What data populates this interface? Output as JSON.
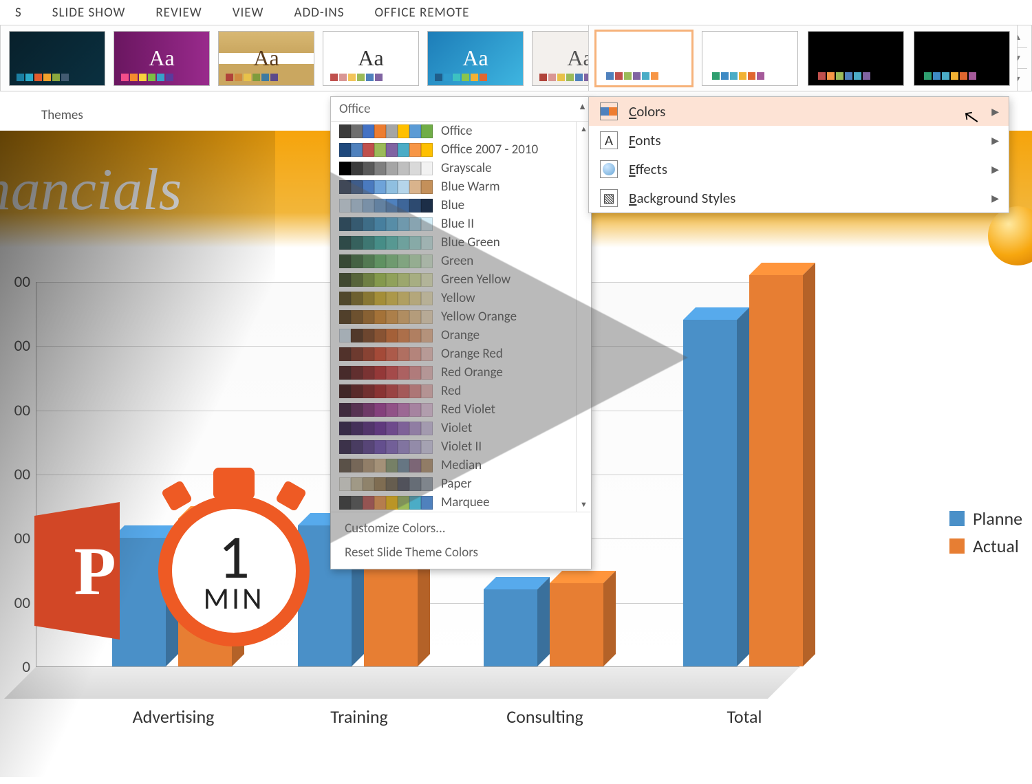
{
  "ribbon_tabs": [
    "S",
    "SLIDE SHOW",
    "REVIEW",
    "VIEW",
    "ADD-INS",
    "OFFICE REMOTE"
  ],
  "themes_label": "Themes",
  "theme_thumbs": [
    {
      "cls": "tt-dark",
      "aa": "",
      "pal": [
        "#1b7fa3",
        "#2aa9c9",
        "#e25a2c",
        "#f0a12b",
        "#8aa83e",
        "#425b71"
      ]
    },
    {
      "cls": "tt-purpl",
      "aa": "Aa",
      "pal": [
        "#f24d8a",
        "#f58b2e",
        "#f7d13d",
        "#7bc043",
        "#36a2c9",
        "#5a3b9c"
      ]
    },
    {
      "cls": "tt-wood",
      "aa": "Aa",
      "pal": [
        "#b0433a",
        "#d08a3f",
        "#e8c24a",
        "#7e9b3c",
        "#3f7aa1",
        "#5c4a8a"
      ]
    },
    {
      "cls": "tt-white",
      "aa": "Aa",
      "pal": [
        "#c0504d",
        "#d99694",
        "#f2c45a",
        "#9bbb59",
        "#4f81bd",
        "#8064a2"
      ]
    },
    {
      "cls": "tt-blue",
      "aa": "Aa",
      "pal": [
        "#205e8a",
        "#2e9bcd",
        "#3dc1c1",
        "#8ac54b",
        "#f2b233",
        "#e0662f"
      ]
    },
    {
      "cls": "tt-grey",
      "aa": "Aa",
      "pal": [
        "#b0433a",
        "#d99694",
        "#e8c24a",
        "#9bbb59",
        "#4f81bd",
        "#8064a2"
      ]
    }
  ],
  "variant_thumbs": [
    {
      "sel": true,
      "dark": false,
      "pal": [
        "#4f81bd",
        "#c0504d",
        "#9bbb59",
        "#8064a2",
        "#4bacc6",
        "#f79646"
      ]
    },
    {
      "sel": false,
      "dark": false,
      "pal": [
        "#2e9e6f",
        "#3e8ac4",
        "#4bacc6",
        "#f2b233",
        "#e0662f",
        "#a55a9a"
      ]
    },
    {
      "sel": false,
      "dark": true,
      "pal": [
        "#c0504d",
        "#f79646",
        "#9bbb59",
        "#4f81bd",
        "#4bacc6",
        "#8064a2"
      ]
    },
    {
      "sel": false,
      "dark": true,
      "pal": [
        "#2e9e6f",
        "#3e8ac4",
        "#4bacc6",
        "#f2b233",
        "#e0662f",
        "#a55a9a"
      ]
    }
  ],
  "colors_panel": {
    "header": "Office",
    "rows": [
      {
        "label": "Office",
        "sw": [
          "#3b3b3b",
          "#6f6f6f",
          "#4472c4",
          "#ed7d31",
          "#a5a5a5",
          "#ffc000",
          "#5b9bd5",
          "#70ad47"
        ]
      },
      {
        "label": "Office 2007 - 2010",
        "sw": [
          "#1f497d",
          "#4f81bd",
          "#c0504d",
          "#9bbb59",
          "#8064a2",
          "#4bacc6",
          "#f79646",
          "#ffc000"
        ]
      },
      {
        "label": "Grayscale",
        "sw": [
          "#000000",
          "#3b3b3b",
          "#595959",
          "#7f7f7f",
          "#a5a5a5",
          "#bfbfbf",
          "#d9d9d9",
          "#f2f2f2"
        ]
      },
      {
        "label": "Blue Warm",
        "sw": [
          "#2e3b55",
          "#3e5c8a",
          "#4a7abf",
          "#6ea3d9",
          "#8fbfe0",
          "#b5d5ea",
          "#d9b38c",
          "#c4905a"
        ]
      },
      {
        "label": "Blue",
        "sw": [
          "#dbe9f5",
          "#b5d0ea",
          "#8fb7df",
          "#699dd3",
          "#4f81bd",
          "#3e6699",
          "#2d4a70",
          "#1c2e47"
        ]
      },
      {
        "label": "Blue II",
        "sw": [
          "#0f3b57",
          "#1c5a80",
          "#2a7aa8",
          "#3a99cf",
          "#55b1df",
          "#7ec6e8",
          "#a9daef",
          "#d4edf7"
        ]
      },
      {
        "label": "Blue Green",
        "sw": [
          "#103f3c",
          "#1d6660",
          "#2a8c84",
          "#38b2a8",
          "#55c5bb",
          "#7dd5cd",
          "#a7e4de",
          "#d1f2ef"
        ]
      },
      {
        "label": "Green",
        "sw": [
          "#1f3d1a",
          "#356633",
          "#4c8f4c",
          "#62b866",
          "#7ec97f",
          "#9ed99b",
          "#bfe9b9",
          "#e0f4dc"
        ]
      },
      {
        "label": "Green Yellow",
        "sw": [
          "#2f3d14",
          "#556b23",
          "#7c9932",
          "#a3c742",
          "#b7d45a",
          "#cbdf7b",
          "#dfea9f",
          "#f1f4c7"
        ]
      },
      {
        "label": "Yellow",
        "sw": [
          "#4a3c0a",
          "#7a6410",
          "#aa8c18",
          "#d9b420",
          "#e7c43f",
          "#eed167",
          "#f4df93",
          "#faeec2"
        ]
      },
      {
        "label": "Yellow Orange",
        "sw": [
          "#4a2d0a",
          "#7a4a10",
          "#aa6718",
          "#d98420",
          "#e79a3f",
          "#eeb267",
          "#f4cb93",
          "#fae3c2"
        ]
      },
      {
        "label": "Orange",
        "sw": [
          "#d9e8f5",
          "#4a220a",
          "#7a3810",
          "#aa4e18",
          "#d96420",
          "#e77e3f",
          "#ee9a67",
          "#f4ba93"
        ]
      },
      {
        "label": "Orange Red",
        "sw": [
          "#4a150a",
          "#7a2310",
          "#aa3118",
          "#d93f20",
          "#e75a3f",
          "#ee7e67",
          "#f4a393",
          "#fac9c2"
        ]
      },
      {
        "label": "Red Orange",
        "sw": [
          "#3a0a0a",
          "#661010",
          "#921818",
          "#bd2020",
          "#d93f3f",
          "#e76767",
          "#ee9393",
          "#f4c2c2"
        ]
      },
      {
        "label": "Red",
        "sw": [
          "#300000",
          "#590808",
          "#821010",
          "#ab1818",
          "#c73232",
          "#d95959",
          "#e98a8a",
          "#f4bcbc"
        ]
      },
      {
        "label": "Red Violet",
        "sw": [
          "#2e0a2a",
          "#55164d",
          "#7c2270",
          "#a32e94",
          "#b84da8",
          "#cb73bd",
          "#dda0d2",
          "#efcde8"
        ]
      },
      {
        "label": "Violet",
        "sw": [
          "#1e0a3a",
          "#351259",
          "#4c1a78",
          "#632297",
          "#7c3fb0",
          "#9866c4",
          "#b796d8",
          "#d8c8ec"
        ]
      },
      {
        "label": "Violet II",
        "sw": [
          "#26163f",
          "#3d2666",
          "#55368c",
          "#6c47b3",
          "#8363c4",
          "#9e87d3",
          "#bcaee2",
          "#dbd6f1"
        ]
      },
      {
        "label": "Median",
        "sw": [
          "#5a4a3c",
          "#8a7157",
          "#b89872",
          "#d9b98e",
          "#8a9b6e",
          "#6e8aa1",
          "#946e8a",
          "#b8946e"
        ]
      },
      {
        "label": "Paper",
        "sw": [
          "#f0eee6",
          "#d3c7a6",
          "#b6a178",
          "#997b4c",
          "#6e6048",
          "#4a4c5c",
          "#6e7a8a",
          "#9aa4b0"
        ]
      },
      {
        "label": "Marquee",
        "sw": [
          "#2a2a2a",
          "#4a4a4a",
          "#c0504d",
          "#f79646",
          "#ffc000",
          "#9bbb59",
          "#4bacc6",
          "#4f81bd"
        ]
      }
    ],
    "footer": {
      "customize": "Customize Colors...",
      "reset": "Reset Slide Theme Colors"
    }
  },
  "flyout": {
    "items": [
      {
        "key": "colors",
        "label": "Colors",
        "accel": "C",
        "hl": true
      },
      {
        "key": "fonts",
        "label": "Fonts",
        "accel": "F",
        "hl": false
      },
      {
        "key": "effects",
        "label": "Effects",
        "accel": "E",
        "hl": false
      },
      {
        "key": "background",
        "label": "Background Styles",
        "accel": "B",
        "hl": false
      }
    ]
  },
  "slide": {
    "title": "r financials"
  },
  "legend": {
    "planned": "Planne",
    "actual": "Actual"
  },
  "badge": {
    "one": "1",
    "min": "MIN"
  },
  "chart_data": {
    "type": "bar",
    "title": "",
    "xlabel": "",
    "ylabel": "",
    "ylim": [
      0,
      600
    ],
    "ytick_step": 100,
    "categories": [
      "Advertising",
      "Training",
      "Consulting",
      "Total"
    ],
    "series": [
      {
        "name": "Planned",
        "color": "#4a90c8",
        "values": [
          200,
          220,
          120,
          540
        ]
      },
      {
        "name": "Actual",
        "color": "#e77e33",
        "values": [
          230,
          250,
          130,
          610
        ]
      }
    ]
  }
}
